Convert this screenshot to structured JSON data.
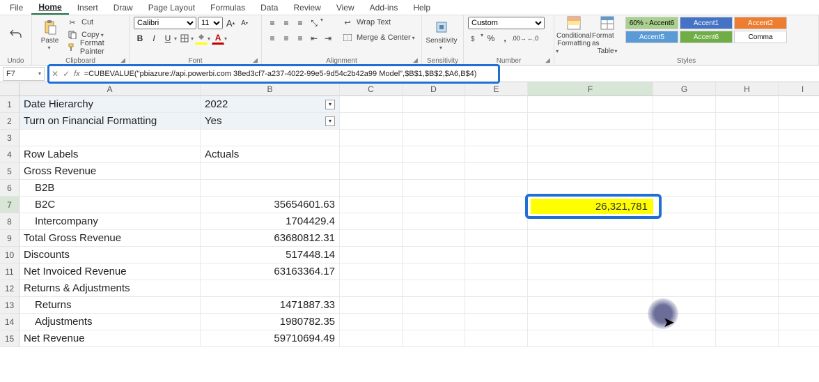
{
  "menu": {
    "items": [
      "File",
      "Home",
      "Insert",
      "Draw",
      "Page Layout",
      "Formulas",
      "Data",
      "Review",
      "View",
      "Add-ins",
      "Help"
    ],
    "active": 1
  },
  "ribbon": {
    "undo": {
      "label": "Undo"
    },
    "clipboard": {
      "label": "Clipboard",
      "paste": "Paste",
      "cut": "Cut",
      "copy": "Copy",
      "fp": "Format Painter"
    },
    "font": {
      "label": "Font",
      "name": "Calibri",
      "size": "11",
      "incr": "A",
      "decr": "A"
    },
    "alignment": {
      "label": "Alignment",
      "wrap": "Wrap Text",
      "merge": "Merge & Center"
    },
    "sensitivity": {
      "btn": "Sensitivity",
      "label": "Sensitivity"
    },
    "number": {
      "label": "Number",
      "format": "Custom"
    },
    "styles": {
      "label": "Styles",
      "cond": "Conditional",
      "cond2": "Formatting",
      "fat": "Format as",
      "fat2": "Table",
      "cells": [
        {
          "t": "60% - Accent6",
          "bg": "#a9d08e",
          "fg": "#000"
        },
        {
          "t": "Accent1",
          "bg": "#4472c4",
          "fg": "#fff"
        },
        {
          "t": "Accent2",
          "bg": "#ed7d31",
          "fg": "#fff"
        },
        {
          "t": "Accent5",
          "bg": "#5b9bd5",
          "fg": "#fff"
        },
        {
          "t": "Accent6",
          "bg": "#70ad47",
          "fg": "#fff"
        },
        {
          "t": "Comma",
          "bg": "#fff",
          "fg": "#000"
        }
      ]
    }
  },
  "namebox": "F7",
  "formula": "=CUBEVALUE(\"pbiazure://api.powerbi.com 38ed3cf7-a237-4022-99e5-9d54c2b42a99 Model\",$B$1,$B$2,$A6,B$4)",
  "columns": [
    "A",
    "B",
    "C",
    "D",
    "E",
    "F",
    "G",
    "H",
    "I"
  ],
  "rows": 15,
  "cells": {
    "A1": "Date Hierarchy",
    "B1": "2022",
    "A2": "Turn on Financial Formatting",
    "B2": "Yes",
    "A4": "Row Labels",
    "B4": "Actuals",
    "A5": "Gross Revenue",
    "A6": "  B2B",
    "A7": "  B2C",
    "B7": "35654601.63",
    "A8": "  Intercompany",
    "B8": "1704429.4",
    "A9": "Total Gross Revenue",
    "B9": "63680812.31",
    "A10": "Discounts",
    "B10": "517448.14",
    "A11": "Net Invoiced Revenue",
    "B11": "63163364.17",
    "A12": "Returns & Adjustments",
    "A13": "  Returns",
    "B13": "1471887.33",
    "A14": "  Adjustments",
    "B14": "1980782.35",
    "A15": "Net Revenue",
    "B15": "59710694.49"
  },
  "f7_display": "26,321,781",
  "selected": {
    "col": "F",
    "row": 7
  }
}
